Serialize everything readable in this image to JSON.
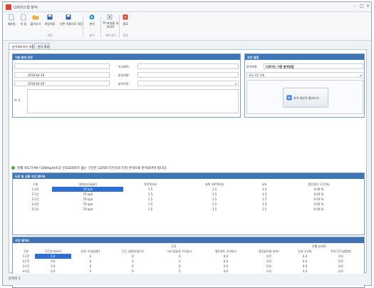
{
  "window": {
    "title": "디바이스형 분석",
    "min_glyph": "–",
    "max_glyph": "□",
    "close_glyph": "×"
  },
  "ribbon": {
    "buttons": [
      {
        "label": "새파일"
      },
      {
        "label": "저 장"
      },
      {
        "label": "불러오기"
      },
      {
        "label": "파일저장"
      },
      {
        "label": "다른 이름으로 저장"
      },
      {
        "label": "분석"
      },
      {
        "label": "TF 파일을 내보내기"
      },
      {
        "label": "종료"
      }
    ],
    "groups": [
      "파일",
      "분석",
      "내보내기",
      "종료"
    ]
  },
  "tabs": [
    {
      "label": "분석파라미터 설정"
    },
    {
      "label": "분석 결과"
    }
  ],
  "basic_panel": {
    "title": "기본 분석 조건",
    "fields": [
      {
        "label": "과제명",
        "value": ""
      },
      {
        "label": "조사일자",
        "value": "2018-02-16"
      },
      {
        "label": "분석일자",
        "value": "2018-02-20"
      },
      {
        "label": "비 고",
        "value": ""
      }
    ],
    "right_fields": [
      {
        "label": "조사위치",
        "value": ""
      },
      {
        "label": "분석자명",
        "value": ""
      },
      {
        "label": "분석기준",
        "value": ""
      }
    ]
  },
  "cond_panel": {
    "title": "조건 설정",
    "type_label": "분석유형",
    "type_value": "디바이스 기준 분석방법",
    "dropdown_value": "속도구간 1개",
    "upload_label": "분석 대상의 불러오기"
  },
  "notice": "현재 속도가 90~100(kph)이고 신호교차로가 없는 구간은 [교차로구간/신호구간] 분석으로 분석되어야 합니다.",
  "speed_panel": {
    "title": "도로 및 교통 구간 데이터",
    "headers": [
      "구분",
      "설계속도(kph)",
      "차로폭(m)",
      "좌측 차로폭(m)",
      "km",
      "종단경사 구간(%)"
    ],
    "rows": [
      [
        "1구간",
        "70 kph",
        "1.5",
        "1.5",
        "1.5",
        "0.00 %"
      ],
      [
        "2구간",
        "70 kph",
        "1.5",
        "1.5",
        "1.5",
        "0.00 %"
      ],
      [
        "3구간",
        "70 kph",
        "1.5",
        "1.5",
        "1.5",
        "0.00 %"
      ],
      [
        "4구간",
        "70 kph",
        "1.5",
        "1.5",
        "1.5",
        "0.00 %"
      ],
      [
        "5구간",
        "70 kph",
        "1.5",
        "1.5",
        "1.5",
        "0.00 %"
      ]
    ]
  },
  "lane_panel": {
    "title": "구간 데이터",
    "group_header": "구간",
    "group_header2": "진행 교차로",
    "headers": [
      "구분",
      "구간길이(km)",
      "차로 수(일방향)",
      "구간 교통량(대/시)",
      "버스정류장 수(개소)",
      "횡단보도 수(개소)",
      "중앙분리대 (km)",
      "신호 수(개)",
      "주차구간(일방향)"
    ],
    "rows": [
      [
        "1구간",
        "0.0",
        "0",
        "0",
        "0",
        "0.0",
        "0.0",
        "0.0",
        "0.0"
      ],
      [
        "2구간",
        "0.0",
        "0",
        "0",
        "0",
        "0.0",
        "0.0",
        "0.0",
        "0.0"
      ],
      [
        "3구간",
        "0.0",
        "0",
        "0",
        "0",
        "0.0",
        "0.0",
        "0.0",
        "0.0"
      ],
      [
        "4구간",
        "0.0",
        "0",
        "0",
        "0",
        "0.0",
        "0.0",
        "0.0",
        "0.0"
      ],
      [
        "5구간",
        "0.0",
        "0",
        "0",
        "0",
        "0.0",
        "0.0",
        "0.0",
        "0.0"
      ]
    ]
  },
  "status": {
    "tab": "분석목 1"
  }
}
